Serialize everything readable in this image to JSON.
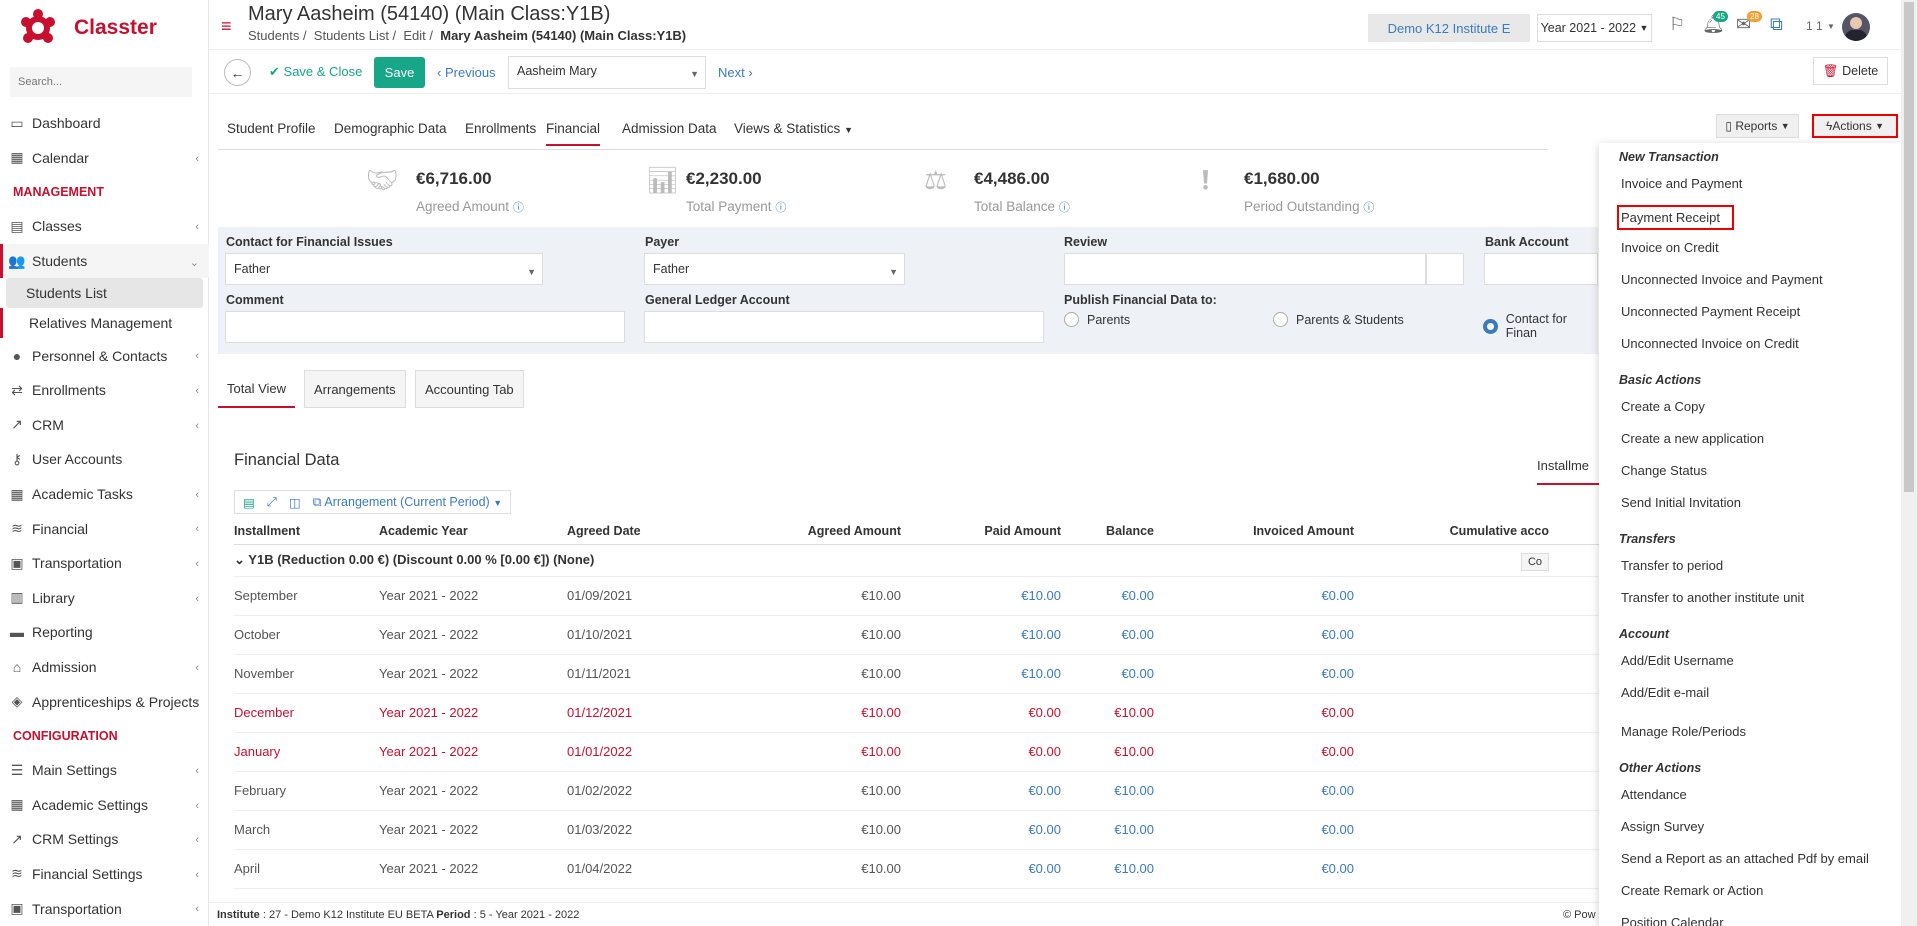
{
  "app": {
    "name": "Classter",
    "search_placeholder": "Search..."
  },
  "sidebar": {
    "items": [
      {
        "label": "Dashboard",
        "icon": "laptop-icon"
      },
      {
        "label": "Calendar",
        "icon": "calendar-icon"
      }
    ],
    "management_label": "MANAGEMENT",
    "mgmt_items": [
      {
        "label": "Classes",
        "icon": "grid-icon"
      },
      {
        "label": "Students",
        "icon": "users-icon"
      }
    ],
    "students_sub": [
      "Students List",
      "Relatives Management"
    ],
    "more_items": [
      {
        "label": "Personnel & Contacts"
      },
      {
        "label": "Enrollments"
      },
      {
        "label": "CRM"
      },
      {
        "label": "User Accounts"
      },
      {
        "label": "Academic Tasks"
      },
      {
        "label": "Financial"
      },
      {
        "label": "Transportation"
      },
      {
        "label": "Library"
      },
      {
        "label": "Reporting"
      },
      {
        "label": "Admission"
      },
      {
        "label": "Apprenticeships & Projects"
      }
    ],
    "configuration_label": "CONFIGURATION",
    "config_items": [
      {
        "label": "Main Settings"
      },
      {
        "label": "Academic Settings"
      },
      {
        "label": "CRM Settings"
      },
      {
        "label": "Financial Settings"
      },
      {
        "label": "Transportation"
      }
    ]
  },
  "header": {
    "title": "Mary Aasheim (54140) (Main Class:Y1B)",
    "breadcrumb": [
      "Students",
      "Students List",
      "Edit"
    ],
    "breadcrumb_current": "Mary Aasheim (54140) (Main Class:Y1B)",
    "institute": "Demo K12 Institute E",
    "year": "Year 2021 - 2022",
    "badge_messages": "45",
    "badge_mail": "28",
    "user_count": "1 1"
  },
  "toolbar": {
    "save_close": "Save & Close",
    "save": "Save",
    "previous": "Previous",
    "student": "Aasheim Mary",
    "next": "Next",
    "delete": "Delete"
  },
  "tabs": [
    "Student Profile",
    "Demographic Data",
    "Enrollments",
    "Financial",
    "Admission Data",
    "Views & Statistics"
  ],
  "buttons": {
    "reports": "Reports",
    "actions": "Actions"
  },
  "stats": [
    {
      "value": "€6,716.00",
      "label": "Agreed Amount"
    },
    {
      "value": "€2,230.00",
      "label": "Total Payment"
    },
    {
      "value": "€4,486.00",
      "label": "Total Balance"
    },
    {
      "value": "€1,680.00",
      "label": "Period Outstanding"
    }
  ],
  "form": {
    "contact_label": "Contact for Financial Issues",
    "contact_value": "Father",
    "payer_label": "Payer",
    "payer_value": "Father",
    "review_label": "Review",
    "bank_label": "Bank Account",
    "comment_label": "Comment",
    "gl_label": "General Ledger Account",
    "publish_label": "Publish Financial Data to:",
    "radio_parents": "Parents",
    "radio_parents_students": "Parents & Students",
    "radio_contact": "Contact for Finan"
  },
  "subtabs": [
    "Total View",
    "Arrangements",
    "Accounting Tab"
  ],
  "financial": {
    "title": "Financial Data",
    "installments_tab": "Installme",
    "arrangement": "Arrangement (Current Period)",
    "columns": [
      "Installment",
      "Academic Year",
      "Agreed Date",
      "Agreed Amount",
      "Paid Amount",
      "Balance",
      "Invoiced Amount",
      "Cumulative acco"
    ],
    "group": "Y1B (Reduction 0.00 €) (Discount 0.00 % [0.00 €]) (None)",
    "group_btn": "Co",
    "rows": [
      {
        "month": "September",
        "year": "Year 2021 - 2022",
        "date": "01/09/2021",
        "agreed": "€10.00",
        "paid": "€10.00",
        "balance": "€0.00",
        "invoiced": "€0.00",
        "overdue": false
      },
      {
        "month": "October",
        "year": "Year 2021 - 2022",
        "date": "01/10/2021",
        "agreed": "€10.00",
        "paid": "€10.00",
        "balance": "€0.00",
        "invoiced": "€0.00",
        "overdue": false
      },
      {
        "month": "November",
        "year": "Year 2021 - 2022",
        "date": "01/11/2021",
        "agreed": "€10.00",
        "paid": "€10.00",
        "balance": "€0.00",
        "invoiced": "€0.00",
        "overdue": false
      },
      {
        "month": "December",
        "year": "Year 2021 - 2022",
        "date": "01/12/2021",
        "agreed": "€10.00",
        "paid": "€0.00",
        "balance": "€10.00",
        "invoiced": "€0.00",
        "overdue": true
      },
      {
        "month": "January",
        "year": "Year 2021 - 2022",
        "date": "01/01/2022",
        "agreed": "€10.00",
        "paid": "€0.00",
        "balance": "€10.00",
        "invoiced": "€0.00",
        "overdue": true
      },
      {
        "month": "February",
        "year": "Year 2021 - 2022",
        "date": "01/02/2022",
        "agreed": "€10.00",
        "paid": "€0.00",
        "balance": "€10.00",
        "invoiced": "€0.00",
        "overdue": false
      },
      {
        "month": "March",
        "year": "Year 2021 - 2022",
        "date": "01/03/2022",
        "agreed": "€10.00",
        "paid": "€0.00",
        "balance": "€10.00",
        "invoiced": "€0.00",
        "overdue": false
      },
      {
        "month": "April",
        "year": "Year 2021 - 2022",
        "date": "01/04/2022",
        "agreed": "€10.00",
        "paid": "€0.00",
        "balance": "€10.00",
        "invoiced": "€0.00",
        "overdue": false
      }
    ]
  },
  "footer": {
    "institute_label": "Institute",
    "institute_value": ": 27 - Demo K12 Institute EU BETA",
    "period_label": "Period",
    "period_value": ": 5 - Year 2021 - 2022",
    "powered": "Pow"
  },
  "actions_menu": {
    "new_transaction": "New Transaction",
    "nt_items": [
      "Invoice and Payment",
      "Payment Receipt",
      "Invoice on Credit",
      "Unconnected Invoice and Payment",
      "Unconnected Payment Receipt",
      "Unconnected Invoice on Credit"
    ],
    "basic_actions": "Basic Actions",
    "ba_items": [
      "Create a Copy",
      "Create a new application",
      "Change Status",
      "Send Initial Invitation"
    ],
    "transfers": "Transfers",
    "tr_items": [
      "Transfer to period",
      "Transfer to another institute unit"
    ],
    "account": "Account",
    "ac_items": [
      "Add/Edit Username",
      "Add/Edit e-mail",
      "Manage Role/Periods"
    ],
    "other_actions": "Other Actions",
    "oa_items": [
      "Attendance",
      "Assign Survey",
      "Send a Report as an attached Pdf by email",
      "Create Remark or Action",
      "Position Calendar"
    ]
  },
  "colors": {
    "brand": "#c8102e",
    "accent": "#18a689",
    "link": "#3a7bbf"
  }
}
